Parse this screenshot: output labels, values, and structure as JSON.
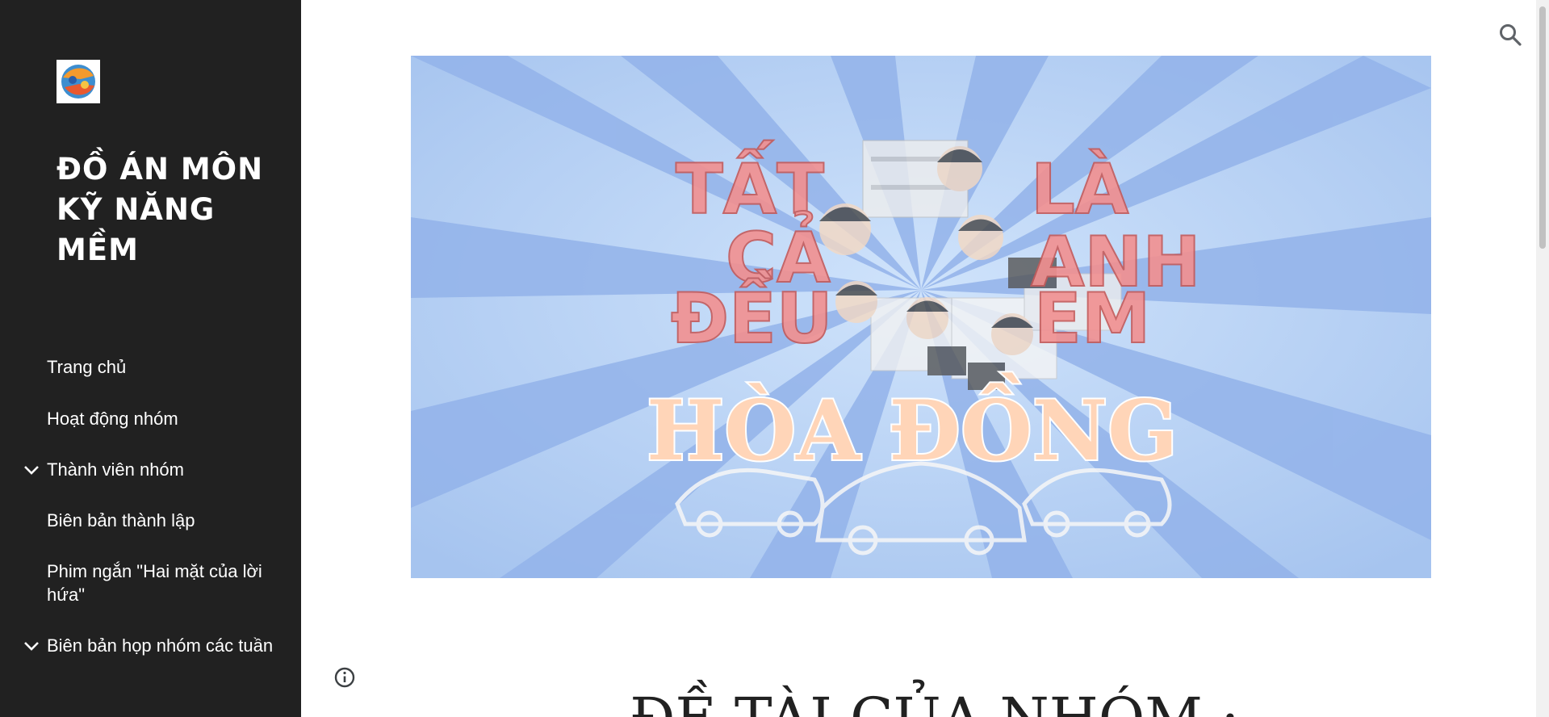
{
  "site": {
    "title": "ĐỒ ÁN MÔN KỸ NĂNG MỀM",
    "logo_icon": "group-logo-icon"
  },
  "nav": {
    "items": [
      {
        "label": "Trang chủ",
        "has_children": false
      },
      {
        "label": "Hoạt động nhóm",
        "has_children": false
      },
      {
        "label": "Thành viên nhóm",
        "has_children": true
      },
      {
        "label": "Biên bản thành lập",
        "has_children": false
      },
      {
        "label": "Phim ngắn \"Hai mặt của lời hứa\"",
        "has_children": false
      },
      {
        "label": "Biên bản họp nhóm các tuần",
        "has_children": true
      }
    ]
  },
  "banner": {
    "text_left": [
      "TẤT",
      "CẢ",
      "ĐỀU"
    ],
    "text_right": [
      "LÀ",
      "ANH",
      "EM"
    ],
    "text_bottom": "HÒA ĐỒNG"
  },
  "main": {
    "heading": "ĐỀ TÀI CỦA NHÓM :"
  },
  "icons": {
    "search": "search-icon",
    "info": "info-icon",
    "chevron": "chevron-down-icon"
  },
  "colors": {
    "sidebar_bg": "#212121",
    "banner_bg": "#a9c7ef",
    "banner_text_red": "#f08a8a",
    "banner_text_peach": "#ffd3b6"
  }
}
